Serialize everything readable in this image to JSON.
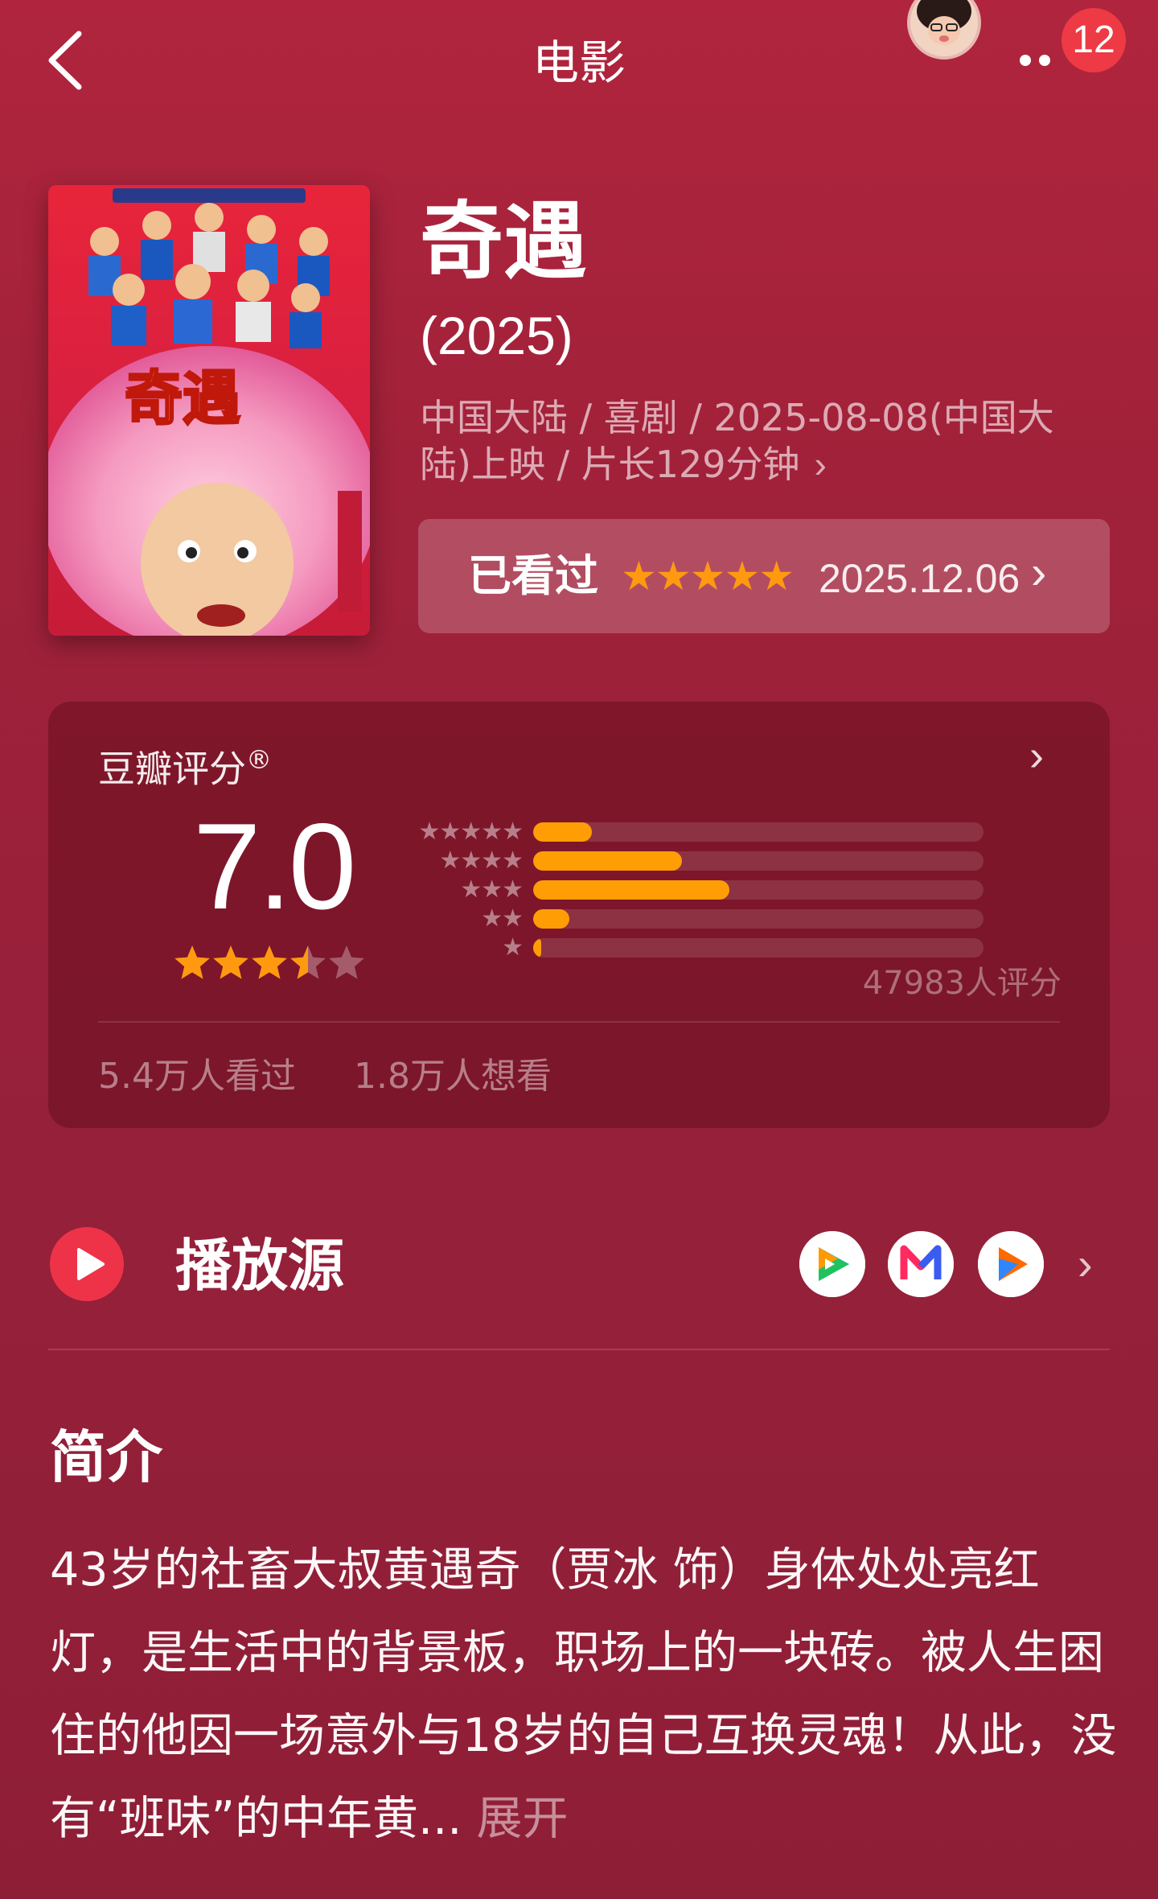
{
  "header": {
    "title": "电影",
    "notification_count": "12"
  },
  "movie": {
    "title": "奇遇",
    "year": "(2025)",
    "meta_line": "中国大陆 / 喜剧 / 2025-08-08(中国大陆)上映 / 片长129分钟",
    "meta_chevron": "›"
  },
  "watched": {
    "label": "已看过",
    "stars": "★★★★★",
    "user_rating": 5,
    "date": "2025.12.06",
    "chevron": "›"
  },
  "rating": {
    "label": "豆瓣评分",
    "registered_mark": "®",
    "score": "7.0",
    "score_out_of_10": 7.0,
    "chevron": "›",
    "count_text": "47983人评分",
    "distribution": [
      {
        "stars": "★★★★★",
        "fraction": 0.13
      },
      {
        "stars": "★★★★",
        "fraction": 0.33
      },
      {
        "stars": "★★★",
        "fraction": 0.435
      },
      {
        "stars": "★★",
        "fraction": 0.08
      },
      {
        "stars": "★",
        "fraction": 0.018
      }
    ],
    "watched_text": "5.4万人看过",
    "want_text": "1.8万人想看"
  },
  "play_source": {
    "label": "播放源",
    "apps": [
      "tencent-video-icon",
      "mgtv-icon",
      "youku-icon"
    ],
    "chevron": "›"
  },
  "synopsis": {
    "title": "简介",
    "text": "43岁的社畜大叔黄遇奇（贾冰 饰）身体处处亮红灯，是生活中的背景板，职场上的一块砖。被人生困住的他因一场意外与18岁的自己互换灵魂！从此，没有“班味”的中年黄...",
    "expand_label": "展开"
  },
  "colors": {
    "background": "#a1213a",
    "accent_star": "#ff9a10",
    "badge": "#ee3a44"
  }
}
